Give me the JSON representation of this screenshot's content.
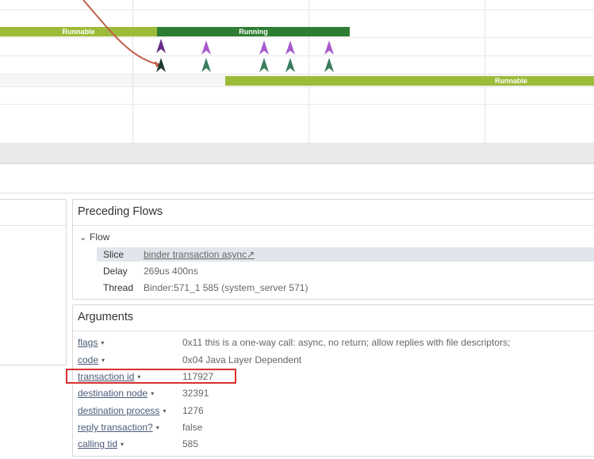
{
  "timeline": {
    "bars": [
      {
        "label": "Runnable",
        "state": "runnable"
      },
      {
        "label": "Running",
        "state": "running"
      },
      {
        "label": "Runnable",
        "state": "runnable"
      }
    ],
    "colors": {
      "runnable": "#9dbb3a",
      "running": "#2e7d32",
      "flow_arrow": "#c0604a",
      "marker_purple": "#a95bd0",
      "marker_green": "#3a7d5c"
    }
  },
  "preceding_flows": {
    "title": "Preceding Flows",
    "flow_label": "Flow",
    "rows": [
      {
        "key": "Slice",
        "value": "binder transaction async",
        "link": true
      },
      {
        "key": "Delay",
        "value": "269us 400ns",
        "link": false
      },
      {
        "key": "Thread",
        "value": "Binder:571_1 585 (system_server 571)",
        "link": false
      }
    ]
  },
  "arguments": {
    "title": "Arguments",
    "rows": [
      {
        "key": "flags",
        "value": "0x11 this is a one-way call: async, no return; allow replies with file descriptors;"
      },
      {
        "key": "code",
        "value": "0x04 Java Layer Dependent"
      },
      {
        "key": "transaction id",
        "value": "117927"
      },
      {
        "key": "destination node",
        "value": "32391"
      },
      {
        "key": "destination process",
        "value": "1276"
      },
      {
        "key": "reply transaction?",
        "value": "false"
      },
      {
        "key": "calling tid",
        "value": "585"
      }
    ]
  },
  "icons": {
    "external_link": "↗",
    "caret": "▾",
    "chevron": "⌄"
  }
}
